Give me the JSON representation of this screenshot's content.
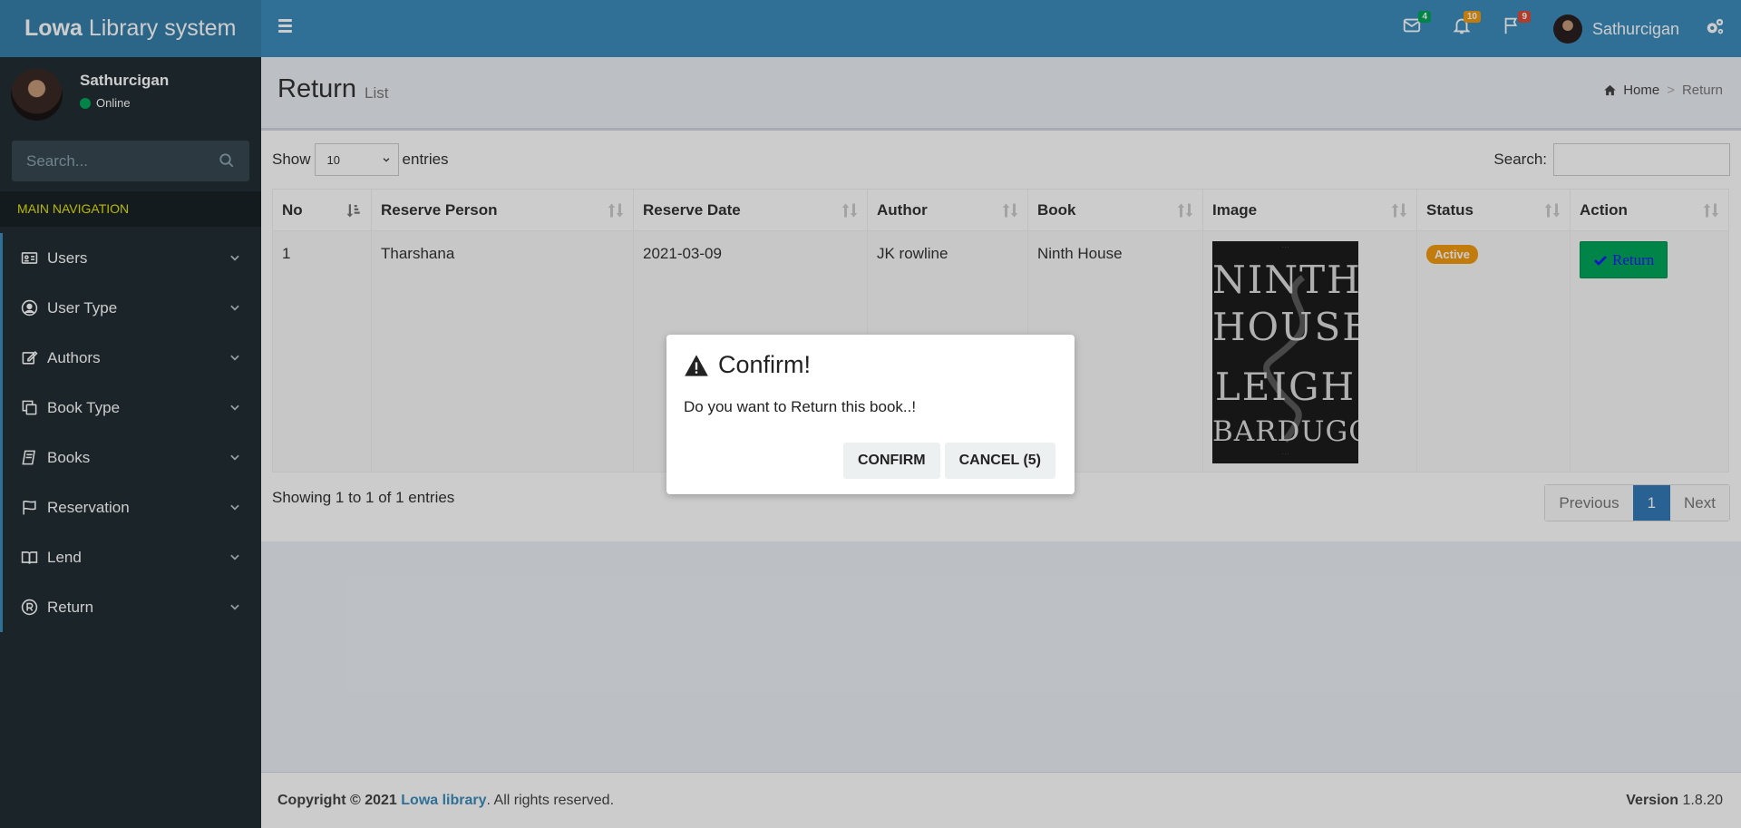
{
  "header": {
    "logo_bold": "Lowa",
    "logo_rest": " Library system",
    "messages_count": "4",
    "notifications_count": "10",
    "tasks_count": "9",
    "user_name": "Sathurcigan"
  },
  "sidebar": {
    "user_name": "Sathurcigan",
    "user_status": "Online",
    "search_placeholder": "Search...",
    "nav_header": "MAIN NAVIGATION",
    "items": [
      {
        "label": "Users",
        "icon": "id-card-icon"
      },
      {
        "label": "User Type",
        "icon": "user-circle-icon"
      },
      {
        "label": "Authors",
        "icon": "edit-icon"
      },
      {
        "label": "Book Type",
        "icon": "copy-icon"
      },
      {
        "label": "Books",
        "icon": "book-icon"
      },
      {
        "label": "Reservation",
        "icon": "flag-icon"
      },
      {
        "label": "Lend",
        "icon": "open-book-icon"
      },
      {
        "label": "Return",
        "icon": "registered-icon"
      }
    ]
  },
  "page": {
    "title": "Return",
    "subtitle": "List",
    "breadcrumb_home": "Home",
    "breadcrumb_current": "Return"
  },
  "table_controls": {
    "show_label": "Show",
    "page_size": "10",
    "entries_label": "entries",
    "search_label": "Search:",
    "info": "Showing 1 to 1 of 1 entries",
    "prev": "Previous",
    "current_page": "1",
    "next": "Next"
  },
  "table": {
    "columns": [
      "No",
      "Reserve Person",
      "Reserve Date",
      "Author",
      "Book",
      "Image",
      "Status",
      "Action"
    ],
    "rows": [
      {
        "no": "1",
        "person": "Tharshana",
        "date": "2021-03-09",
        "author": "JK rowline",
        "book": "Ninth House",
        "cover_line1": "NINTH",
        "cover_line2": "HOUSE",
        "cover_line3": "LEIGH",
        "cover_line4": "BARDUGO",
        "status": "Active",
        "action": "Return"
      }
    ]
  },
  "footer": {
    "copyright": "Copyright © 2021 ",
    "brand": "Lowa library",
    "rights": ". All rights reserved.",
    "version_label": "Version",
    "version": " 1.8.20"
  },
  "dialog": {
    "title": "Confirm!",
    "message": "Do you want to Return this book..!",
    "confirm": "CONFIRM",
    "cancel": "CANCEL (5)"
  },
  "colors": {
    "header": "#3c8dbc",
    "logo_bg": "#367fa9",
    "sidebar": "#222d32",
    "active_badge": "#f39c12",
    "return_button": "#00a65a",
    "page_active": "#337ab7"
  }
}
